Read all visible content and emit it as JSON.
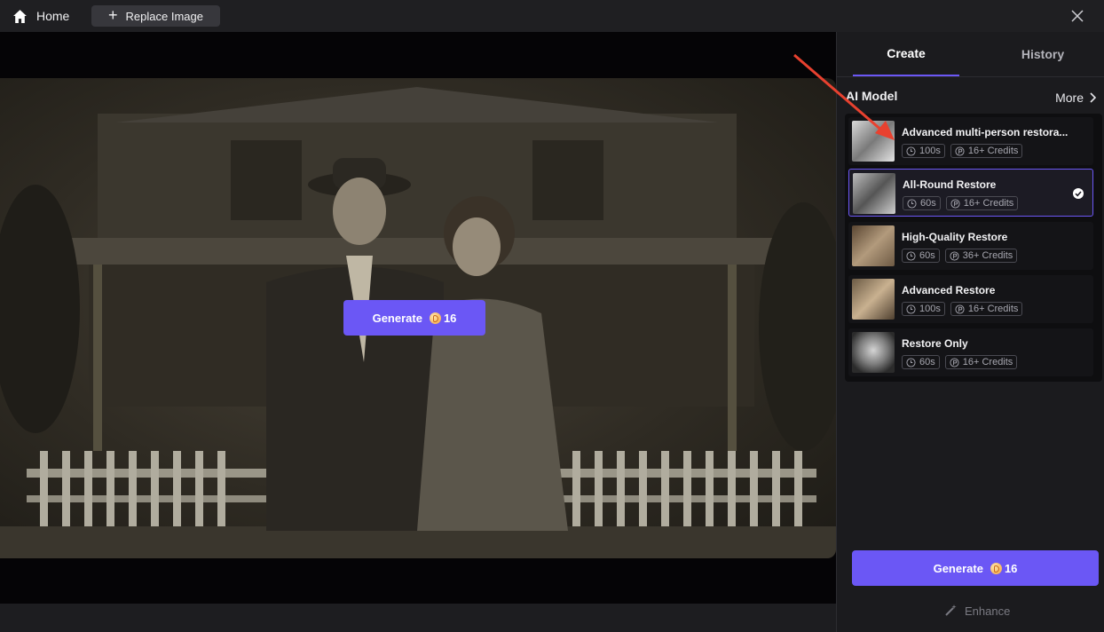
{
  "topbar": {
    "home_label": "Home",
    "replace_label": "Replace Image",
    "icons": {
      "home": "home-icon",
      "plus": "plus-icon",
      "close": "close-icon"
    }
  },
  "overlay_generate": {
    "label": "Generate",
    "credits": "16"
  },
  "panel": {
    "tabs": [
      {
        "label": "Create",
        "active": true
      },
      {
        "label": "History",
        "active": false
      }
    ],
    "ai_model_label": "AI Model",
    "more_label": "More",
    "models": [
      {
        "name": "Advanced multi-person restora...",
        "time": "100s",
        "credits": "16+ Credits",
        "selected": false
      },
      {
        "name": "All-Round Restore",
        "time": "60s",
        "credits": "16+ Credits",
        "selected": true
      },
      {
        "name": "High-Quality Restore",
        "time": "60s",
        "credits": "36+ Credits",
        "selected": false
      },
      {
        "name": "Advanced Restore",
        "time": "100s",
        "credits": "16+ Credits",
        "selected": false
      },
      {
        "name": "Restore Only",
        "time": "60s",
        "credits": "16+ Credits",
        "selected": false
      }
    ],
    "generate": {
      "label": "Generate",
      "credits": "16"
    },
    "enhance_label": "Enhance"
  },
  "colors": {
    "accent": "#6b57f5",
    "background": "#1b1b1e",
    "annotation_arrow": "#e8412f"
  }
}
